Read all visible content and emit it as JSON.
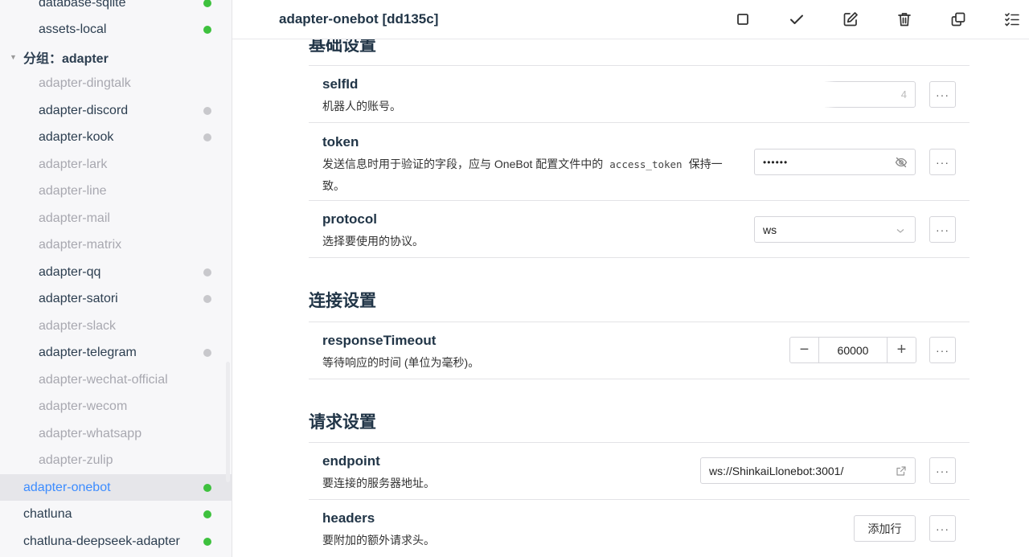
{
  "sidebar": {
    "items": [
      {
        "label": "database-sqlite",
        "state": "normal",
        "dot": "green"
      },
      {
        "label": "assets-local",
        "state": "normal",
        "dot": "green"
      },
      {
        "label": "分组：adapter",
        "state": "group",
        "dot": ""
      },
      {
        "label": "adapter-dingtalk",
        "state": "disabled",
        "dot": ""
      },
      {
        "label": "adapter-discord",
        "state": "normal",
        "dot": "gray"
      },
      {
        "label": "adapter-kook",
        "state": "normal",
        "dot": "gray"
      },
      {
        "label": "adapter-lark",
        "state": "disabled",
        "dot": ""
      },
      {
        "label": "adapter-line",
        "state": "disabled",
        "dot": ""
      },
      {
        "label": "adapter-mail",
        "state": "disabled",
        "dot": ""
      },
      {
        "label": "adapter-matrix",
        "state": "disabled",
        "dot": ""
      },
      {
        "label": "adapter-qq",
        "state": "normal",
        "dot": "gray"
      },
      {
        "label": "adapter-satori",
        "state": "normal",
        "dot": "gray"
      },
      {
        "label": "adapter-slack",
        "state": "disabled",
        "dot": ""
      },
      {
        "label": "adapter-telegram",
        "state": "normal",
        "dot": "gray"
      },
      {
        "label": "adapter-wechat-official",
        "state": "disabled",
        "dot": ""
      },
      {
        "label": "adapter-wecom",
        "state": "disabled",
        "dot": ""
      },
      {
        "label": "adapter-whatsapp",
        "state": "disabled",
        "dot": ""
      },
      {
        "label": "adapter-zulip",
        "state": "disabled",
        "dot": ""
      },
      {
        "label": "adapter-onebot",
        "state": "active",
        "dot": "green"
      },
      {
        "label": "chatluna",
        "state": "normal",
        "dot": "green"
      },
      {
        "label": "chatluna-deepseek-adapter",
        "state": "normal",
        "dot": "green"
      }
    ]
  },
  "header": {
    "title": "adapter-onebot [dd135c]",
    "icons": [
      "stop-icon",
      "check-icon",
      "edit-icon",
      "trash-icon",
      "copy-icon",
      "checklist-icon"
    ]
  },
  "sections": {
    "basic": {
      "title": "基础设置"
    },
    "connection": {
      "title": "连接设置"
    },
    "request": {
      "title": "请求设置"
    }
  },
  "fields": {
    "selfId": {
      "name": "selfId",
      "desc": "机器人的账号。",
      "value": "4"
    },
    "token": {
      "name": "token",
      "desc_before": "发送信息时用于验证的字段，应与 OneBot 配置文件中的",
      "desc_code": "access_token",
      "desc_after": "保持一致。",
      "value": "••••••"
    },
    "protocol": {
      "name": "protocol",
      "desc": "选择要使用的协议。",
      "value": "ws"
    },
    "responseTimeout": {
      "name": "responseTimeout",
      "desc": "等待响应的时间 (单位为毫秒)。",
      "value": "60000",
      "minus": "−",
      "plus": "+"
    },
    "endpoint": {
      "name": "endpoint",
      "desc": "要连接的服务器地址。",
      "value": "ws://ShinkaiLlonebot:3001/"
    },
    "headers": {
      "name": "headers",
      "desc": "要附加的额外请求头。",
      "button": "添加行"
    }
  },
  "more_label": "···",
  "colors": {
    "accent": "#3c8cff",
    "online": "#3ec13e",
    "offline": "#c8c8cc"
  }
}
